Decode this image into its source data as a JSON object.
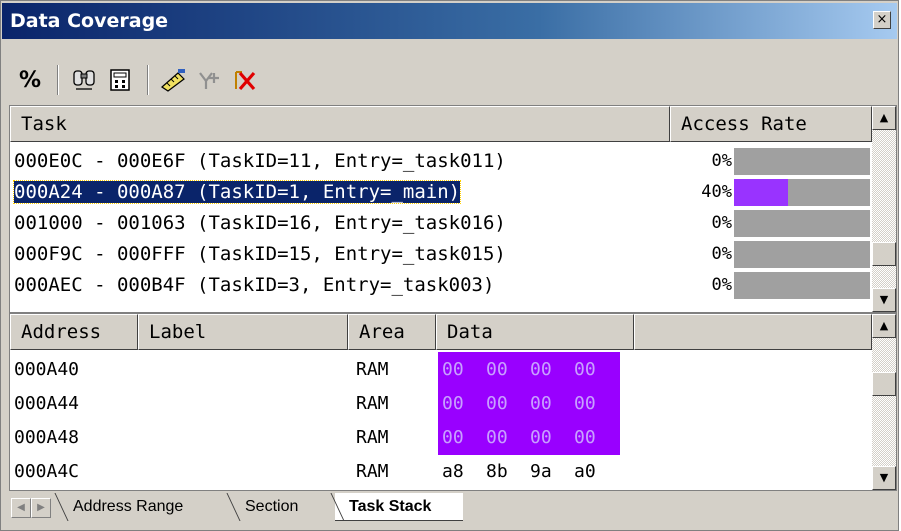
{
  "window": {
    "title": "Data Coverage",
    "close_glyph": "×"
  },
  "toolbar": {
    "percent_label": "%",
    "icons": [
      "percent-icon",
      "binoculars-icon",
      "calculator-icon",
      "measure-icon",
      "add-range-icon",
      "delete-range-icon"
    ]
  },
  "task_table": {
    "columns": [
      "Task",
      "Access Rate"
    ],
    "rows": [
      {
        "task": "000E0C - 000E6F (TaskID=11, Entry=_task011)",
        "rate_text": "0%",
        "rate": 0
      },
      {
        "task": "000A24 - 000A87 (TaskID=1, Entry=_main)",
        "rate_text": "40%",
        "rate": 0.4,
        "selected": true
      },
      {
        "task": "001000 - 001063 (TaskID=16, Entry=_task016)",
        "rate_text": "0%",
        "rate": 0
      },
      {
        "task": "000F9C - 000FFF (TaskID=15, Entry=_task015)",
        "rate_text": "0%",
        "rate": 0
      },
      {
        "task": "000AEC - 000B4F (TaskID=3, Entry=_task003)",
        "rate_text": "0%",
        "rate": 0
      }
    ]
  },
  "memory_table": {
    "columns": [
      "Address",
      "Label",
      "Area",
      "Data"
    ],
    "rows": [
      {
        "address": "000A40",
        "label": "",
        "area": "RAM",
        "data": [
          "00",
          "00",
          "00",
          "00"
        ],
        "covered": true
      },
      {
        "address": "000A44",
        "label": "",
        "area": "RAM",
        "data": [
          "00",
          "00",
          "00",
          "00"
        ],
        "covered": true
      },
      {
        "address": "000A48",
        "label": "",
        "area": "RAM",
        "data": [
          "00",
          "00",
          "00",
          "00"
        ],
        "covered": true
      },
      {
        "address": "000A4C",
        "label": "",
        "area": "RAM",
        "data": [
          "a8",
          "8b",
          "9a",
          "a0"
        ],
        "covered": false
      }
    ]
  },
  "tabs": [
    {
      "label": "Address Range",
      "active": false
    },
    {
      "label": "Section",
      "active": false
    },
    {
      "label": "Task Stack",
      "active": true
    }
  ],
  "colors": {
    "coverage": "#9933ff",
    "data_highlight": "#9900ff",
    "selection": "#0a246a"
  }
}
